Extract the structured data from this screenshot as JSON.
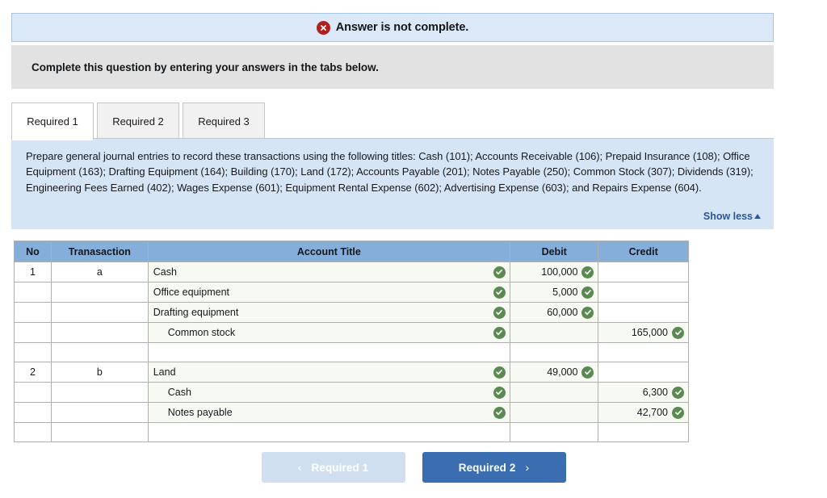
{
  "alert": {
    "icon": "error-x-icon",
    "text": "Answer is not complete.",
    "bg_color": "#dbe8f7",
    "icon_color": "#b02020"
  },
  "instruction": {
    "text": "Complete this question by entering your answers in the tabs below."
  },
  "tabs": [
    {
      "label": "Required 1",
      "active": true
    },
    {
      "label": "Required 2",
      "active": false
    },
    {
      "label": "Required 3",
      "active": false
    }
  ],
  "panel": {
    "text": "Prepare general journal entries to record these transactions using the following titles: Cash (101); Accounts Receivable (106); Prepaid Insurance (108); Office Equipment (163); Drafting Equipment (164); Building (170); Land (172); Accounts Payable (201); Notes Payable (250); Common Stock (307); Dividends (319); Engineering Fees Earned (402); Wages Expense (601); Equipment Rental Expense (602); Advertising Expense (603); and Repairs Expense (604).",
    "show_less_label": "Show less",
    "show_less_icon": "caret-up-icon",
    "bg_color": "#d6e5f5"
  },
  "table": {
    "header_bg": "#85aeda",
    "columns": [
      "No",
      "Tranasaction",
      "Account Title",
      "Debit",
      "Credit"
    ],
    "rows": [
      {
        "no": "1",
        "transaction": "a",
        "account": "Cash",
        "indent": false,
        "debit": "100,000",
        "credit": "",
        "account_check": true,
        "debit_check": true,
        "credit_check": false,
        "empty": false
      },
      {
        "no": "",
        "transaction": "",
        "account": "Office equipment",
        "indent": false,
        "debit": "5,000",
        "credit": "",
        "account_check": true,
        "debit_check": true,
        "credit_check": false,
        "empty": false
      },
      {
        "no": "",
        "transaction": "",
        "account": "Drafting equipment",
        "indent": false,
        "debit": "60,000",
        "credit": "",
        "account_check": true,
        "debit_check": true,
        "credit_check": false,
        "empty": false
      },
      {
        "no": "",
        "transaction": "",
        "account": "Common stock",
        "indent": true,
        "debit": "",
        "credit": "165,000",
        "account_check": true,
        "debit_check": false,
        "credit_check": true,
        "empty": false
      },
      {
        "no": "",
        "transaction": "",
        "account": "",
        "indent": false,
        "debit": "",
        "credit": "",
        "account_check": false,
        "debit_check": false,
        "credit_check": false,
        "empty": true
      },
      {
        "no": "2",
        "transaction": "b",
        "account": "Land",
        "indent": false,
        "debit": "49,000",
        "credit": "",
        "account_check": true,
        "debit_check": true,
        "credit_check": false,
        "empty": false
      },
      {
        "no": "",
        "transaction": "",
        "account": "Cash",
        "indent": true,
        "debit": "",
        "credit": "6,300",
        "account_check": true,
        "debit_check": false,
        "credit_check": true,
        "empty": false
      },
      {
        "no": "",
        "transaction": "",
        "account": "Notes payable",
        "indent": true,
        "debit": "",
        "credit": "42,700",
        "account_check": true,
        "debit_check": false,
        "credit_check": true,
        "empty": false
      },
      {
        "no": "",
        "transaction": "",
        "account": "",
        "indent": false,
        "debit": "",
        "credit": "",
        "account_check": false,
        "debit_check": false,
        "credit_check": false,
        "empty": true
      }
    ]
  },
  "footer": {
    "prev_label": "Required 1",
    "prev_icon": "chevron-left-icon",
    "next_label": "Required 2",
    "next_icon": "chevron-right-icon",
    "next_color": "#3a6eb1",
    "prev_color": "#cfdff0"
  }
}
